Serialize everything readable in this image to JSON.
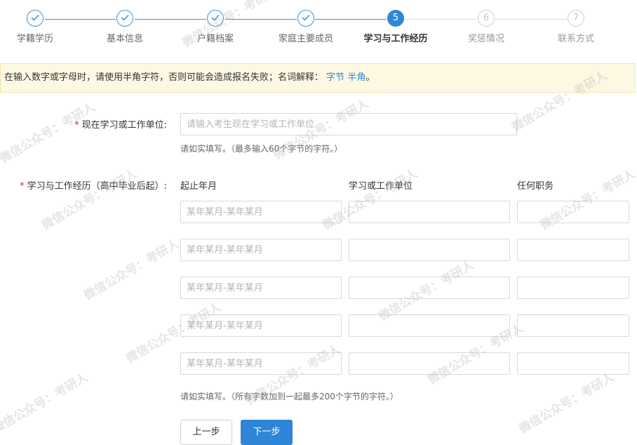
{
  "steps": [
    {
      "label": "学籍学历",
      "status": "done"
    },
    {
      "label": "基本信息",
      "status": "done"
    },
    {
      "label": "户籍档案",
      "status": "done"
    },
    {
      "label": "家庭主要成员",
      "status": "done"
    },
    {
      "label": "学习与工作经历",
      "status": "active",
      "number": "5"
    },
    {
      "label": "奖惩情况",
      "status": "todo",
      "number": "6"
    },
    {
      "label": "联系方式",
      "status": "todo",
      "number": "7"
    }
  ],
  "notice": {
    "text": "在输入数字或字母时，请使用半角字符，否则可能会造成报名失败；名词解释：",
    "link_byte": "字节",
    "link_half": "半角",
    "suffix": "。"
  },
  "current_unit": {
    "required_mark": "*",
    "label": "现在学习或工作单位:",
    "placeholder": "请输入考生现在学习或工作单位",
    "value": "",
    "hint": "请如实填写。（最多输入60个字节的字符。）"
  },
  "experience": {
    "required_mark": "*",
    "label": "学习与工作经历（高中毕业后起）:",
    "columns": [
      "起止年月",
      "学习或工作单位",
      "任何职务"
    ],
    "rows": [
      {
        "period_placeholder": "某年某月-某年某月",
        "period": "",
        "unit": "",
        "position": ""
      },
      {
        "period_placeholder": "某年某月-某年某月",
        "period": "",
        "unit": "",
        "position": ""
      },
      {
        "period_placeholder": "某年某月-某年某月",
        "period": "",
        "unit": "",
        "position": ""
      },
      {
        "period_placeholder": "某年某月-某年某月",
        "period": "",
        "unit": "",
        "position": ""
      },
      {
        "period_placeholder": "某年某月-某年某月",
        "period": "",
        "unit": "",
        "position": ""
      }
    ],
    "hint": "请如实填写。（所有字数加到一起最多200个字节的字符。）"
  },
  "buttons": {
    "prev": "上一步",
    "next": "下一步"
  },
  "watermark": "微信公众号：考研人",
  "colors": {
    "primary": "#2f86d6",
    "required": "#e02020",
    "notice_bg": "#fdf8e2"
  }
}
